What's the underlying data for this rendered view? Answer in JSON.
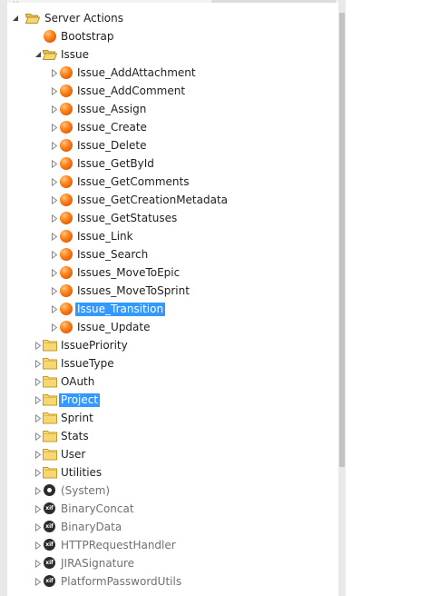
{
  "tree": {
    "root": {
      "label": "Server Actions",
      "expanded": true
    },
    "items": [
      {
        "id": "bootstrap",
        "label": "Bootstrap",
        "kind": "action",
        "level": 1,
        "arrow": "none"
      },
      {
        "id": "issue",
        "label": "Issue",
        "kind": "folder-open",
        "level": 1,
        "arrow": "expanded"
      },
      {
        "id": "issue-addattachment",
        "label": "Issue_AddAttachment",
        "kind": "action",
        "level": 2,
        "arrow": "collapsed"
      },
      {
        "id": "issue-addcomment",
        "label": "Issue_AddComment",
        "kind": "action",
        "level": 2,
        "arrow": "collapsed"
      },
      {
        "id": "issue-assign",
        "label": "Issue_Assign",
        "kind": "action",
        "level": 2,
        "arrow": "collapsed"
      },
      {
        "id": "issue-create",
        "label": "Issue_Create",
        "kind": "action",
        "level": 2,
        "arrow": "collapsed"
      },
      {
        "id": "issue-delete",
        "label": "Issue_Delete",
        "kind": "action",
        "level": 2,
        "arrow": "collapsed"
      },
      {
        "id": "issue-getbyid",
        "label": "Issue_GetById",
        "kind": "action",
        "level": 2,
        "arrow": "collapsed"
      },
      {
        "id": "issue-getcomments",
        "label": "Issue_GetComments",
        "kind": "action",
        "level": 2,
        "arrow": "collapsed"
      },
      {
        "id": "issue-getcreationmetadata",
        "label": "Issue_GetCreationMetadata",
        "kind": "action",
        "level": 2,
        "arrow": "collapsed"
      },
      {
        "id": "issue-getstatuses",
        "label": "Issue_GetStatuses",
        "kind": "action",
        "level": 2,
        "arrow": "collapsed"
      },
      {
        "id": "issue-link",
        "label": "Issue_Link",
        "kind": "action",
        "level": 2,
        "arrow": "collapsed"
      },
      {
        "id": "issue-search",
        "label": "Issue_Search",
        "kind": "action",
        "level": 2,
        "arrow": "collapsed"
      },
      {
        "id": "issues-movetoepic",
        "label": "Issues_MoveToEpic",
        "kind": "action",
        "level": 2,
        "arrow": "collapsed"
      },
      {
        "id": "issues-movetosprint",
        "label": "Issues_MoveToSprint",
        "kind": "action",
        "level": 2,
        "arrow": "collapsed"
      },
      {
        "id": "issue-transition",
        "label": "Issue_Transition",
        "kind": "action",
        "level": 2,
        "arrow": "collapsed",
        "selected": true
      },
      {
        "id": "issue-update",
        "label": "Issue_Update",
        "kind": "action",
        "level": 2,
        "arrow": "collapsed"
      },
      {
        "id": "issuepriority",
        "label": "IssuePriority",
        "kind": "folder",
        "level": 1,
        "arrow": "collapsed"
      },
      {
        "id": "issuetype",
        "label": "IssueType",
        "kind": "folder",
        "level": 1,
        "arrow": "collapsed"
      },
      {
        "id": "oauth",
        "label": "OAuth",
        "kind": "folder",
        "level": 1,
        "arrow": "collapsed"
      },
      {
        "id": "project",
        "label": "Project",
        "kind": "folder",
        "level": 1,
        "arrow": "collapsed",
        "selected": true
      },
      {
        "id": "sprint",
        "label": "Sprint",
        "kind": "folder",
        "level": 1,
        "arrow": "collapsed"
      },
      {
        "id": "stats",
        "label": "Stats",
        "kind": "folder",
        "level": 1,
        "arrow": "collapsed"
      },
      {
        "id": "user",
        "label": "User",
        "kind": "folder",
        "level": 1,
        "arrow": "collapsed"
      },
      {
        "id": "utilities",
        "label": "Utilities",
        "kind": "folder",
        "level": 1,
        "arrow": "collapsed"
      },
      {
        "id": "system",
        "label": "(System)",
        "kind": "system",
        "level": 1,
        "arrow": "collapsed",
        "muted": true
      },
      {
        "id": "binaryconcat",
        "label": "BinaryConcat",
        "kind": "extension",
        "level": 1,
        "arrow": "collapsed",
        "muted": true
      },
      {
        "id": "binarydata",
        "label": "BinaryData",
        "kind": "extension",
        "level": 1,
        "arrow": "collapsed",
        "muted": true
      },
      {
        "id": "httprequesthandler",
        "label": "HTTPRequestHandler",
        "kind": "extension",
        "level": 1,
        "arrow": "collapsed",
        "muted": true
      },
      {
        "id": "jirasignature",
        "label": "JIRASignature",
        "kind": "extension",
        "level": 1,
        "arrow": "collapsed",
        "muted": true
      },
      {
        "id": "platformpasswordutils",
        "label": "PlatformPasswordUtils",
        "kind": "extension",
        "level": 1,
        "arrow": "collapsed",
        "muted": true
      }
    ]
  },
  "icons": {
    "extension_text": "xif"
  },
  "colors": {
    "selection": "#3399ff",
    "action_orange": "#f47a1f",
    "folder_yellow": "#f5d26b",
    "muted_text": "#707070"
  }
}
